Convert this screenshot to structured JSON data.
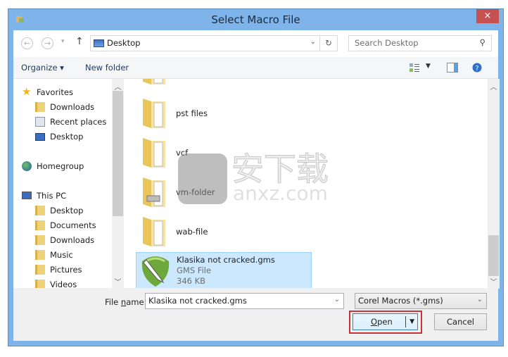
{
  "window": {
    "title": "Select Macro File",
    "close_label": "×"
  },
  "address": {
    "location": "Desktop",
    "search_placeholder": "Search Desktop"
  },
  "toolbar": {
    "organize": "Organize ▾",
    "new_folder": "New folder"
  },
  "nav": {
    "favorites": "Favorites",
    "favorites_items": [
      "Downloads",
      "Recent places",
      "Desktop"
    ],
    "homegroup": "Homegroup",
    "this_pc": "This PC",
    "pc_items": [
      "Desktop",
      "Documents",
      "Downloads",
      "Music",
      "Pictures",
      "Videos"
    ]
  },
  "files": [
    {
      "name": "pst files",
      "type": "folder"
    },
    {
      "name": "vcf",
      "type": "folder"
    },
    {
      "name": "vm-folder",
      "type": "folder"
    },
    {
      "name": "wab-file",
      "type": "folder"
    },
    {
      "name": "Klasika not cracked.gms",
      "type": "GMS File",
      "size": "346 KB",
      "selected": true
    }
  ],
  "bottom": {
    "filename_label_pre": "File ",
    "filename_label_u": "n",
    "filename_label_post": "ame:",
    "filename_value": "Klasika not cracked.gms",
    "filter_value": "Corel Macros (*.gms)",
    "open_u": "O",
    "open_rest": "pen",
    "cancel": "Cancel"
  },
  "watermark": {
    "text": "安下载",
    "sub": "anxz.com"
  }
}
